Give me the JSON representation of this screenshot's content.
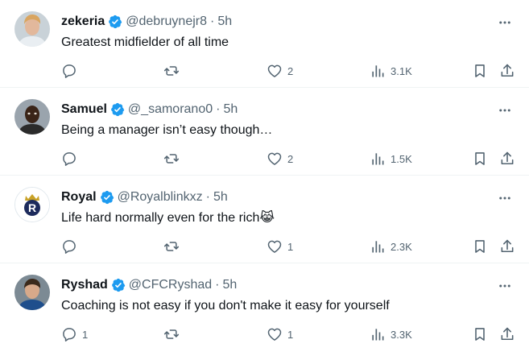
{
  "tweets": [
    {
      "name": "zekeria",
      "handle": "@debruynejr8",
      "dot": "·",
      "time": "5h",
      "text": "Greatest midfielder of all time",
      "emoji": "",
      "replies": "",
      "likes": "2",
      "views": "3.1K"
    },
    {
      "name": "Samuel",
      "handle": "@_samorano0",
      "dot": "·",
      "time": "5h",
      "text": "Being a manager isn’t easy though…",
      "emoji": "",
      "replies": "",
      "likes": "2",
      "views": "1.5K"
    },
    {
      "name": "Royal",
      "handle": "@Royalblinkxz",
      "dot": "·",
      "time": "5h",
      "text": "Life hard normally even for the rich",
      "emoji": "😹",
      "replies": "",
      "likes": "1",
      "views": "2.3K"
    },
    {
      "name": "Ryshad",
      "handle": "@CFCRyshad",
      "dot": "·",
      "time": "5h",
      "text": "Coaching is not easy if you don't make it easy for yourself",
      "emoji": "",
      "replies": "1",
      "likes": "1",
      "views": "3.3K"
    }
  ],
  "avatars": {
    "royal_letter": "R"
  },
  "colors": {
    "verified": "#1d9bf0",
    "secondary_text": "#536471",
    "divider": "#eff3f4"
  },
  "icons": {
    "reply": "reply-icon",
    "retweet": "retweet-icon",
    "like": "heart-icon",
    "views": "views-icon",
    "bookmark": "bookmark-icon",
    "share": "share-icon",
    "more": "more-icon",
    "verified": "verified-badge-icon"
  }
}
